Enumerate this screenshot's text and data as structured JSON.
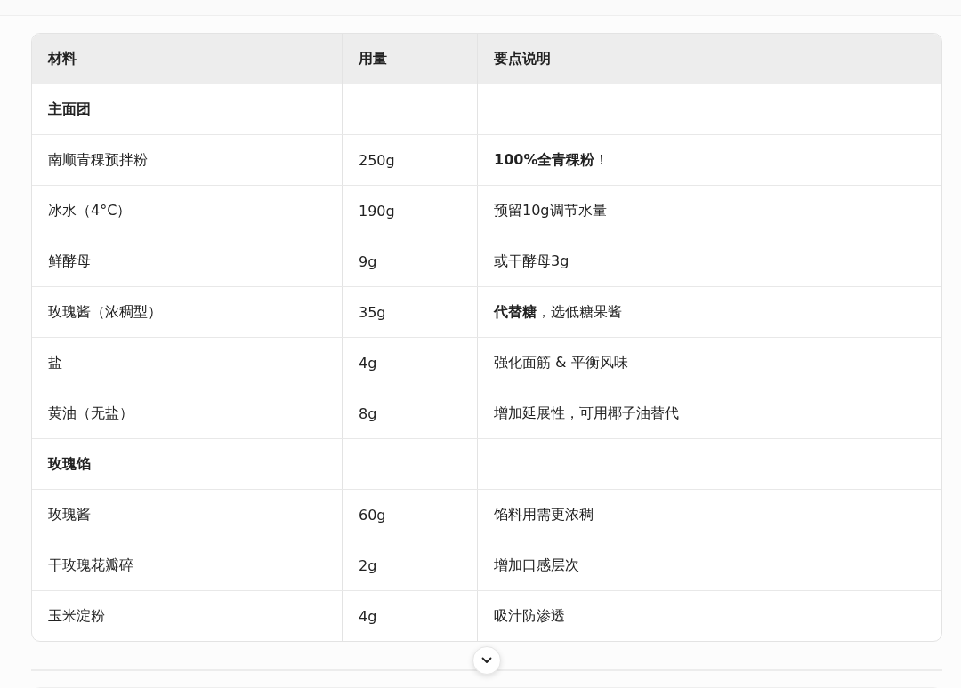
{
  "table": {
    "columns": [
      "材料",
      "用量",
      "要点说明"
    ],
    "rows": [
      {
        "kind": "section",
        "cells": [
          "主面团",
          "",
          ""
        ]
      },
      {
        "kind": "item",
        "cells": [
          "南顺青稞预拌粉",
          "250g",
          "**100%全青稞粉**！"
        ]
      },
      {
        "kind": "item",
        "cells": [
          "冰水（4°C）",
          "190g",
          "预留10g调节水量"
        ]
      },
      {
        "kind": "item",
        "cells": [
          "鲜酵母",
          "9g",
          "或干酵母3g"
        ]
      },
      {
        "kind": "item",
        "cells": [
          "玫瑰酱（浓稠型）",
          "35g",
          "**代替糖**，选低糖果酱"
        ]
      },
      {
        "kind": "item",
        "cells": [
          "盐",
          "4g",
          "强化面筋 & 平衡风味"
        ]
      },
      {
        "kind": "item",
        "cells": [
          "黄油（无盐）",
          "8g",
          "增加延展性，可用椰子油替代"
        ]
      },
      {
        "kind": "section",
        "cells": [
          "玫瑰馅",
          "",
          ""
        ]
      },
      {
        "kind": "item",
        "cells": [
          "玫瑰酱",
          "60g",
          "馅料用需更浓稠"
        ]
      },
      {
        "kind": "item",
        "cells": [
          "干玫瑰花瓣碎",
          "2g",
          "增加口感层次"
        ]
      },
      {
        "kind": "item",
        "cells": [
          "玉米淀粉",
          "4g",
          "吸汁防渗透"
        ]
      }
    ]
  }
}
